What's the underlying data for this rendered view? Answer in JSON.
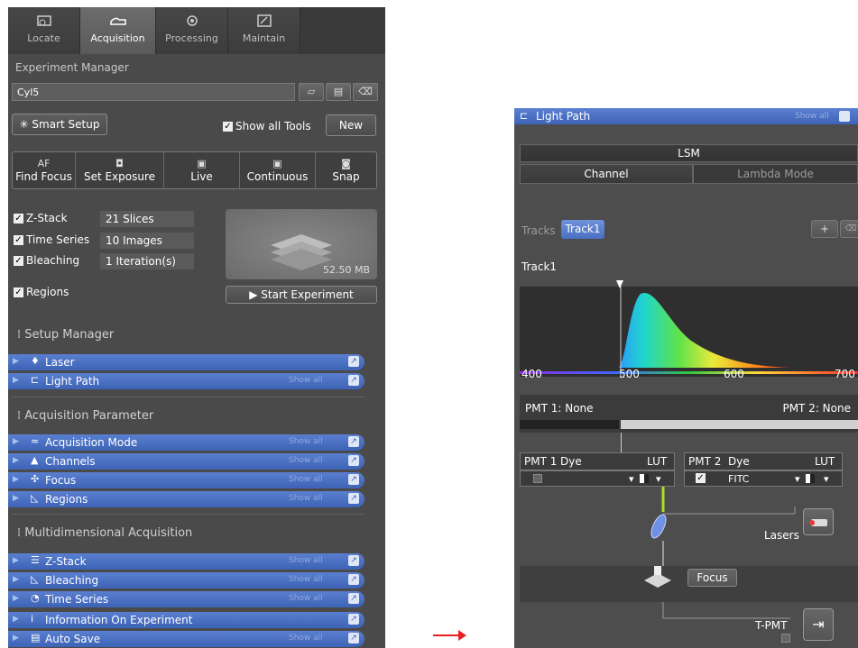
{
  "left_panel": {
    "tabs": [
      {
        "label": "Locate",
        "icon": "locate-icon"
      },
      {
        "label": "Acquisition",
        "icon": "acquisition-icon"
      },
      {
        "label": "Processing",
        "icon": "processing-icon"
      },
      {
        "label": "Maintain",
        "icon": "maintain-icon"
      }
    ],
    "experiment_manager": {
      "title": "Experiment Manager",
      "name": "Cyl5",
      "buttons": [
        "open-icon",
        "save-icon",
        "delete-icon"
      ]
    },
    "smart_setup_label": "Smart Setup",
    "show_all_tools_label": "Show all Tools",
    "new_label": "New",
    "tools": [
      {
        "icon_text": "AF",
        "label": "Find Focus"
      },
      {
        "icon_text": "",
        "label": "Set Exposure"
      },
      {
        "icon_text": "",
        "label": "Live"
      },
      {
        "icon_text": "",
        "label": "Continuous"
      },
      {
        "icon_text": "",
        "label": "Snap"
      }
    ],
    "dimensions": [
      {
        "label": "Z-Stack",
        "value": "21 Slices",
        "checked": true
      },
      {
        "label": "Time Series",
        "value": "10 Images",
        "checked": true
      },
      {
        "label": "Bleaching",
        "value": "1 Iteration(s)",
        "checked": true
      },
      {
        "label": "Regions",
        "value": "",
        "checked": true
      }
    ],
    "data_size": "52.50 MB",
    "start_experiment_label": "Start Experiment",
    "show_all_text": "Show all",
    "groups": [
      {
        "title": "Setup Manager",
        "items": [
          {
            "label": "Laser",
            "show_all": false
          },
          {
            "label": "Light Path",
            "show_all": true
          }
        ]
      },
      {
        "title": "Acquisition Parameter",
        "items": [
          {
            "label": "Acquisition Mode",
            "show_all": true
          },
          {
            "label": "Channels",
            "show_all": true
          },
          {
            "label": "Focus",
            "show_all": true
          },
          {
            "label": "Regions",
            "show_all": true
          }
        ]
      },
      {
        "title": "Multidimensional Acquisition",
        "items": [
          {
            "label": "Z-Stack",
            "show_all": true
          },
          {
            "label": "Bleaching",
            "show_all": true
          },
          {
            "label": "Time Series",
            "show_all": true
          },
          {
            "label": "Information On Experiment",
            "show_all": false
          },
          {
            "label": "Auto Save",
            "show_all": true
          }
        ]
      }
    ]
  },
  "right_panel": {
    "title": "Light Path",
    "show_all_text": "Show all",
    "lsm_label": "LSM",
    "modes": [
      {
        "label": "Channel",
        "active": true
      },
      {
        "label": "Lambda Mode",
        "active": false
      }
    ],
    "tracks_label": "Tracks",
    "track_button": "Track1",
    "track_title": "Track1",
    "spectrum_ticks": [
      "400",
      "500",
      "600",
      "700"
    ],
    "pmt1_label": "PMT 1: None",
    "pmt2_label": "PMT 2: None",
    "dye_tables": [
      {
        "head": "PMT 1",
        "dye_col": "Dye",
        "lut_col": "LUT",
        "checked": false,
        "dye": ""
      },
      {
        "head": "PMT 2",
        "dye_col": "Dye",
        "lut_col": "LUT",
        "checked": true,
        "dye": "FITC"
      }
    ],
    "lasers_label": "Lasers",
    "focus_label": "Focus",
    "tpmt_label": "T-PMT"
  },
  "colors": {
    "accent_blue": "#4a6fc4",
    "panel_bg": "#4a4a4a",
    "arrow_red": "#e8201f"
  }
}
